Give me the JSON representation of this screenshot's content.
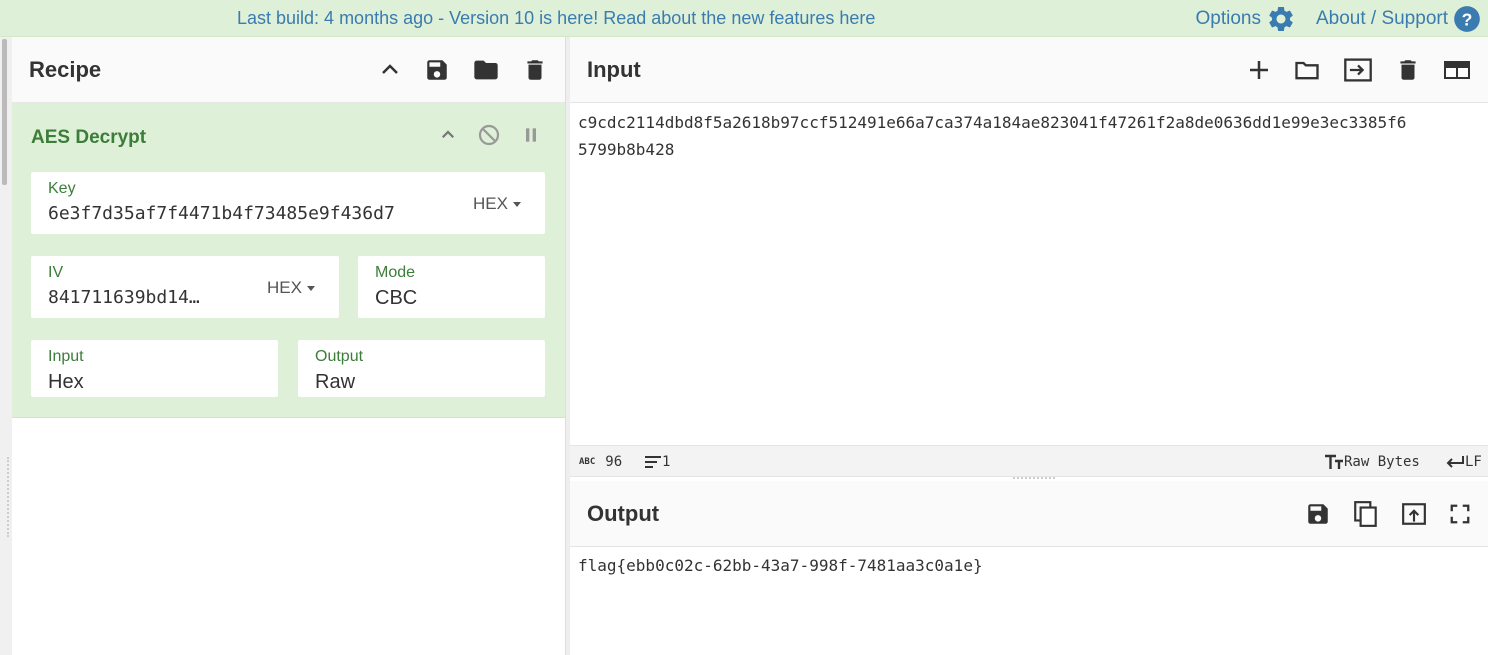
{
  "banner": {
    "message": "Last build: 4 months ago - Version 10 is here! Read about the new features ",
    "link": "here",
    "options": "Options",
    "about": "About / Support",
    "color": "#3a7bb0"
  },
  "recipe": {
    "title": "Recipe",
    "operation": {
      "name": "AES Decrypt",
      "key_label": "Key",
      "key_value": "6e3f7d35af7f4471b4f73485e9f436d7",
      "key_format": "HEX",
      "iv_label": "IV",
      "iv_value": "841711639bd14…",
      "iv_format": "HEX",
      "mode_label": "Mode",
      "mode_value": "CBC",
      "input_label": "Input",
      "input_value": "Hex",
      "output_label": "Output",
      "output_value": "Raw"
    }
  },
  "input": {
    "title": "Input",
    "line1": "c9cdc2114dbd8f5a2618b97ccf512491e66a7ca374a184ae823041f47261f2a8de0636dd1e99e3ec3385f6",
    "line2": "5799b8b428",
    "status": {
      "abc_icon": "ABC",
      "chars": "96",
      "lines": "1",
      "encoding": "Raw Bytes",
      "eol": "LF"
    }
  },
  "output": {
    "title": "Output",
    "text": "flag{ebb0c02c-62bb-43a7-998f-7481aa3c0a1e}"
  },
  "colors": {
    "banner_bg": "#dff0d8",
    "op_green": "#3c7d3a",
    "link_blue": "#3a7bb0"
  }
}
